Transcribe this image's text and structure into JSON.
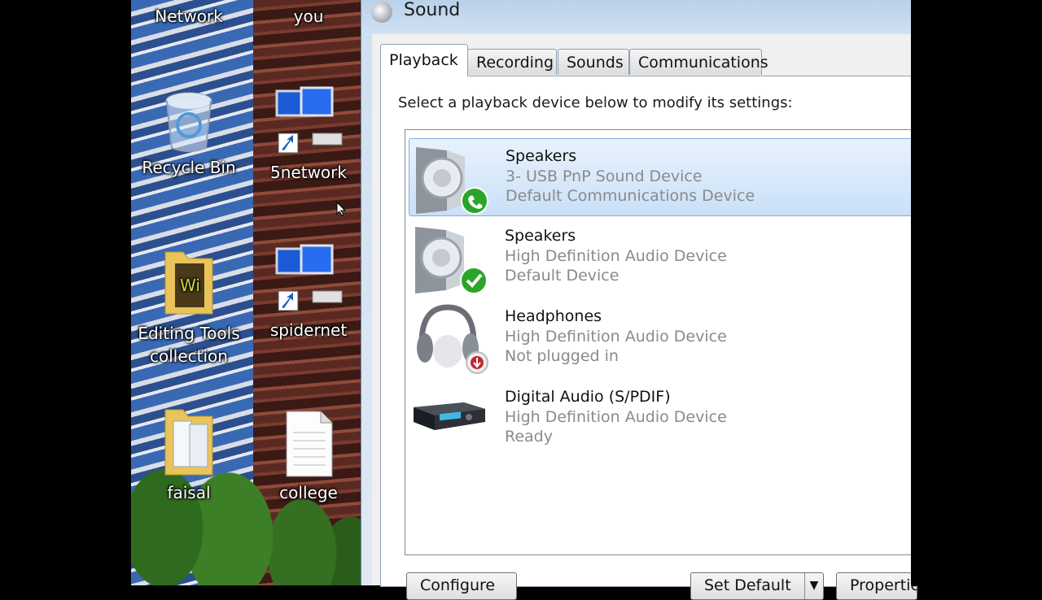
{
  "desktop": {
    "icons": [
      {
        "label": "Network"
      },
      {
        "label": "you"
      },
      {
        "label": "Recycle Bin"
      },
      {
        "label": "5network"
      },
      {
        "label": "Editing Tools collection"
      },
      {
        "label": "spidernet"
      },
      {
        "label": "faisal"
      },
      {
        "label": "college"
      }
    ]
  },
  "dialog": {
    "title": "Sound",
    "tabs": [
      {
        "label": "Playback"
      },
      {
        "label": "Recording"
      },
      {
        "label": "Sounds"
      },
      {
        "label": "Communications"
      }
    ],
    "instruction": "Select a playback device below to modify its settings:",
    "devices": [
      {
        "name": "Speakers",
        "line1": "3- USB PnP Sound Device",
        "line2": "Default Communications Device",
        "icon": "speaker-icon",
        "badge": "phone-badge-icon",
        "selected": true
      },
      {
        "name": "Speakers",
        "line1": "High Definition Audio Device",
        "line2": "Default Device",
        "icon": "speaker-icon",
        "badge": "checkmark-badge-icon",
        "selected": false
      },
      {
        "name": "Headphones",
        "line1": "High Definition Audio Device",
        "line2": "Not plugged in",
        "icon": "headphones-icon",
        "badge": "unplugged-badge-icon",
        "selected": false
      },
      {
        "name": "Digital Audio (S/PDIF)",
        "line1": "High Definition Audio Device",
        "line2": "Ready",
        "icon": "digital-audio-receiver-icon",
        "badge": "",
        "selected": false
      }
    ],
    "buttons": {
      "configure": "Configure",
      "set_default": "Set Default",
      "properties": "Properties"
    }
  },
  "colors": {
    "selected_row": "#c9e0f8",
    "green_badge": "#2aa52a",
    "red_badge": "#c0282d"
  }
}
